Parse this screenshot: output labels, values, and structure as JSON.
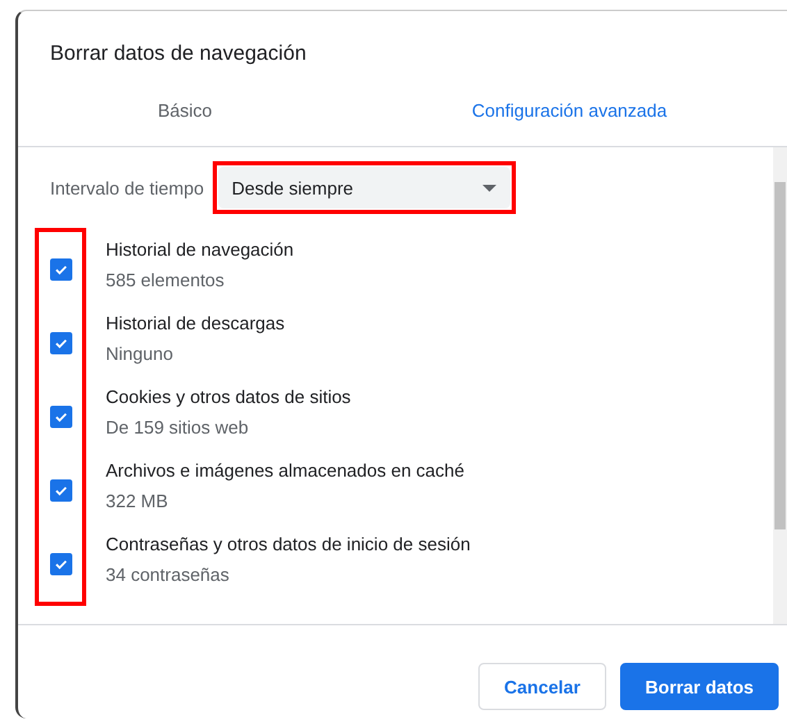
{
  "dialog": {
    "title": "Borrar datos de navegación"
  },
  "tabs": [
    {
      "label": "Básico",
      "selected": false
    },
    {
      "label": "Configuración avanzada",
      "selected": true
    }
  ],
  "time_range": {
    "label": "Intervalo de tiempo",
    "value": "Desde siempre"
  },
  "items": [
    {
      "label": "Historial de navegación",
      "detail": "585 elementos",
      "checked": true
    },
    {
      "label": "Historial de descargas",
      "detail": "Ninguno",
      "checked": true
    },
    {
      "label": "Cookies y otros datos de sitios",
      "detail": "De 159 sitios web",
      "checked": true
    },
    {
      "label": "Archivos e imágenes almacenados en caché",
      "detail": "322 MB",
      "checked": true
    },
    {
      "label": "Contraseñas y otros datos de inicio de sesión",
      "detail": "34 contraseñas",
      "checked": true
    }
  ],
  "buttons": [
    {
      "label": "Cancelar",
      "kind": "secondary"
    },
    {
      "label": "Borrar datos",
      "kind": "primary"
    }
  ]
}
